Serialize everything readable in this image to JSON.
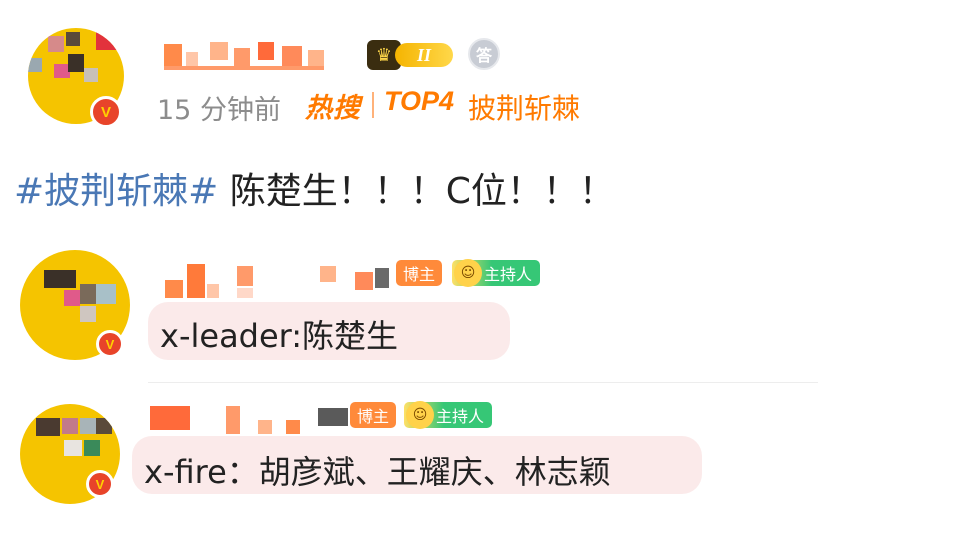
{
  "post": {
    "time": "15 分钟前",
    "hot_logo": "热搜",
    "rank": "TOP4",
    "topic": "披荆斩棘",
    "hashtag": "#披荆斩棘#",
    "text_body": " 陈楚生！！！C位！！！",
    "level_badge": "II"
  },
  "comments": [
    {
      "tag_blogger": "博主",
      "tag_host": "主持人",
      "text": "x-leader:陈楚生"
    },
    {
      "tag_blogger": "博主",
      "tag_host": "主持人",
      "text": "x-fire：胡彦斌、王耀庆、林志颖"
    }
  ],
  "colors": {
    "accent_orange": "#ff7a00",
    "hashtag_blue": "#4a78b5",
    "bubble_pink": "#fbeaea",
    "verified_red": "#e8442a"
  },
  "icons": [
    "crown-icon",
    "medal-icon",
    "verified-icon",
    "host-mascot-icon"
  ]
}
